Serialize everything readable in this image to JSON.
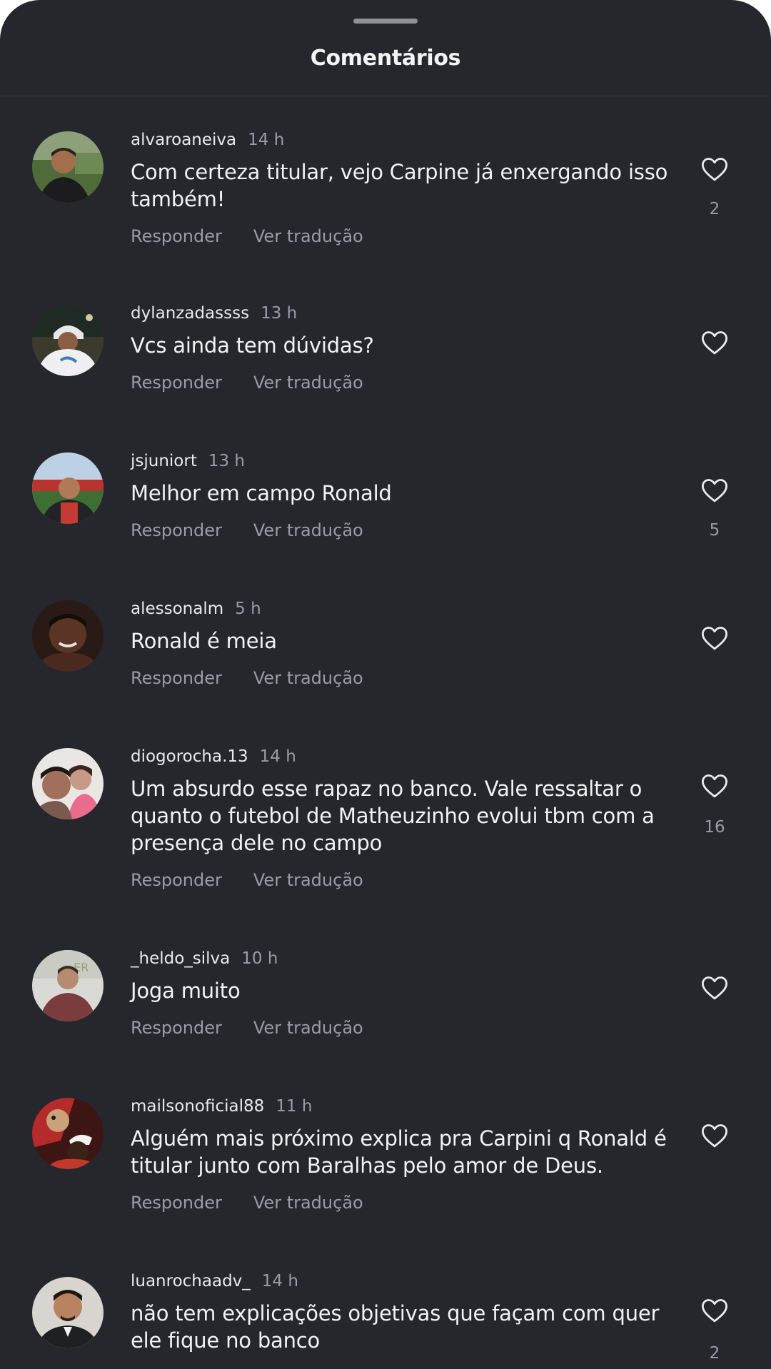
{
  "header": {
    "title": "Comentários"
  },
  "actions": {
    "reply_label": "Responder",
    "translate_label": "Ver tradução"
  },
  "comments": [
    {
      "username": "alvaroaneiva",
      "time": "14 h",
      "text": "Com certeza titular, vejo Carpine já enxergando isso também!",
      "likes": "2"
    },
    {
      "username": "dylanzadassss",
      "time": "13 h",
      "text": "Vcs ainda tem dúvidas?",
      "likes": ""
    },
    {
      "username": "jsjuniort",
      "time": "13 h",
      "text": "Melhor em campo Ronald",
      "likes": "5"
    },
    {
      "username": "alessonalm",
      "time": "5 h",
      "text": "Ronald é meia",
      "likes": ""
    },
    {
      "username": "diogorocha.13",
      "time": "14 h",
      "text": "Um absurdo esse rapaz no banco. Vale ressaltar o quanto o futebol de Matheuzinho evolui tbm com a presença dele no campo",
      "likes": "16"
    },
    {
      "username": "_heldo_silva",
      "time": "10 h",
      "text": "Joga muito",
      "likes": ""
    },
    {
      "username": "mailsonoficial88",
      "time": "11 h",
      "text": "Alguém mais próximo explica pra Carpini q Ronald é titular junto com Baralhas pelo amor de Deus.",
      "likes": ""
    },
    {
      "username": "luanrochaadv_",
      "time": "14 h",
      "text": "não tem explicações objetivas que façam com quer ele fique no banco",
      "likes": "2"
    }
  ],
  "colors": {
    "background": "#25272c",
    "primary_text": "#f1f2f4",
    "secondary_text": "#9a9ca3"
  },
  "icons": {
    "like": "heart-outline-icon"
  }
}
